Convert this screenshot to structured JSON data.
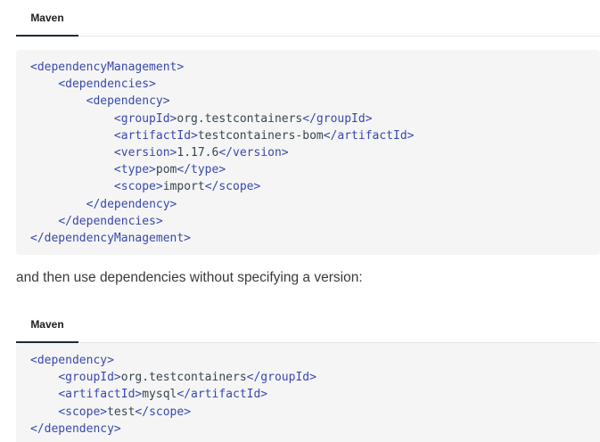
{
  "tab1": {
    "label": "Maven"
  },
  "code1": {
    "lines": [
      {
        "indent": "",
        "open": "<dependencyManagement>",
        "text": "",
        "close": ""
      },
      {
        "indent": "    ",
        "open": "<dependencies>",
        "text": "",
        "close": ""
      },
      {
        "indent": "        ",
        "open": "<dependency>",
        "text": "",
        "close": ""
      },
      {
        "indent": "            ",
        "open": "<groupId>",
        "text": "org.testcontainers",
        "close": "</groupId>"
      },
      {
        "indent": "            ",
        "open": "<artifactId>",
        "text": "testcontainers-bom",
        "close": "</artifactId>"
      },
      {
        "indent": "            ",
        "open": "<version>",
        "text": "1.17.6",
        "close": "</version>"
      },
      {
        "indent": "            ",
        "open": "<type>",
        "text": "pom",
        "close": "</type>"
      },
      {
        "indent": "            ",
        "open": "<scope>",
        "text": "import",
        "close": "</scope>"
      },
      {
        "indent": "        ",
        "open": "</dependency>",
        "text": "",
        "close": ""
      },
      {
        "indent": "    ",
        "open": "</dependencies>",
        "text": "",
        "close": ""
      },
      {
        "indent": "",
        "open": "</dependencyManagement>",
        "text": "",
        "close": ""
      }
    ]
  },
  "prose": {
    "text": "and then use dependencies without specifying a version:"
  },
  "tab2": {
    "label": "Maven"
  },
  "code2": {
    "lines": [
      {
        "indent": "",
        "open": "<dependency>",
        "text": "",
        "close": ""
      },
      {
        "indent": "    ",
        "open": "<groupId>",
        "text": "org.testcontainers",
        "close": "</groupId>"
      },
      {
        "indent": "    ",
        "open": "<artifactId>",
        "text": "mysql",
        "close": "</artifactId>"
      },
      {
        "indent": "    ",
        "open": "<scope>",
        "text": "test",
        "close": "</scope>"
      },
      {
        "indent": "",
        "open": "</dependency>",
        "text": "",
        "close": ""
      }
    ]
  },
  "colors": {
    "tag": "#3949ab",
    "text": "#37474f",
    "code_bg": "#f5f5f5"
  }
}
